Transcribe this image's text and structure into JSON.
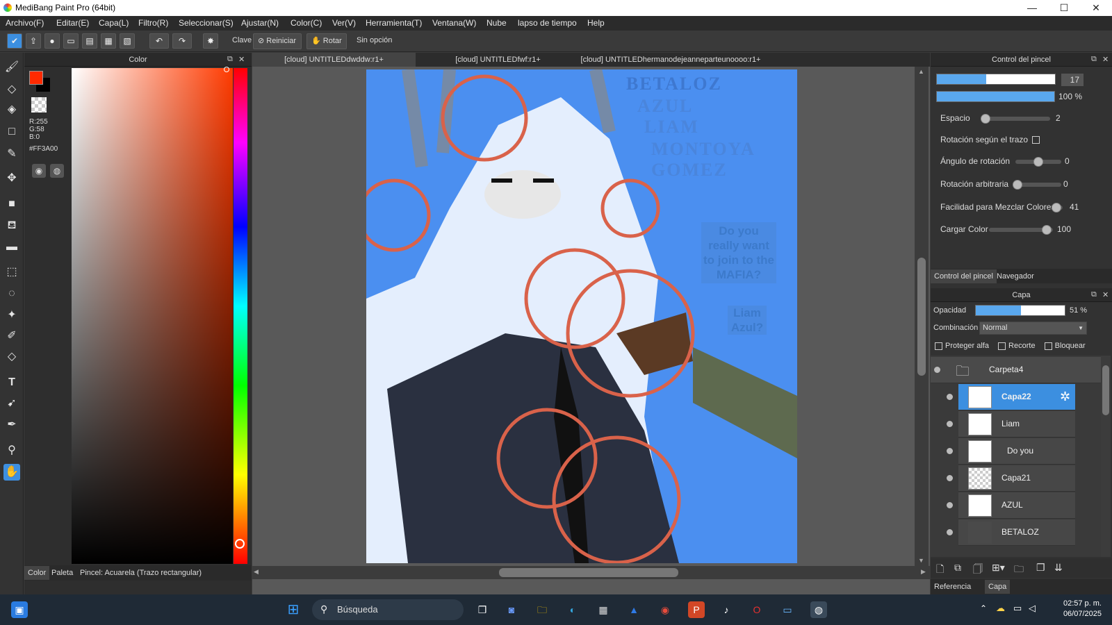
{
  "window": {
    "title": "MediBang Paint Pro (64bit)"
  },
  "menu": [
    "Archivo(F)",
    "Editar(E)",
    "Capa(L)",
    "Filtro(R)",
    "Seleccionar(S)",
    "Ajustar(N)",
    "Color(C)",
    "Ver(V)",
    "Herramienta(T)",
    "Ventana(W)",
    "Nube",
    "lapso de tiempo",
    "Help"
  ],
  "toolbar": {
    "clave": "Clave",
    "reiniciar": "Reiniciar",
    "rotar": "Rotar",
    "sin_opcion": "Sin opción"
  },
  "color_panel": {
    "title": "Color",
    "rgb": [
      "R:255",
      "G:58",
      "B:0"
    ],
    "hex": "#FF3A00",
    "fg_color": "#ff2a00",
    "bottom_tabs": [
      "Color",
      "Paleta"
    ],
    "brush_status": "Pincel: Acuarela (Trazo rectangular)"
  },
  "canvas": {
    "tabs": [
      "[cloud] UNTITLEDdwddw:r1+",
      "[cloud] UNTITLEDfwf:r1+",
      "[cloud] UNTITLEDhermanodejeanneparteunoooo:r1+"
    ],
    "art_text": {
      "betaloz": "BETALOZ",
      "azul": "AZUL",
      "liam": "LIAM",
      "montoya": "MONTOYA",
      "gomez": "GOMEZ",
      "do_you": "Do you really want to join to the MAFIA?",
      "liam_azul": "Liam Azul?"
    }
  },
  "brush_panel": {
    "title": "Control del pincel",
    "size": "17",
    "opacity": "100 %",
    "size_fill": 0.42,
    "rows": [
      {
        "label": "Espacio",
        "value": "2",
        "pos": 0.0
      },
      {
        "label": "Rotación según el trazo",
        "checkbox": true
      },
      {
        "label": "Ángulo de rotación",
        "value": "0",
        "pos": 0.5
      },
      {
        "label": "Rotación arbitraria",
        "value": "0",
        "pos": 0.0
      },
      {
        "label": "Facilidad para Mezclar Colores",
        "value": "41",
        "pos": 0.41
      },
      {
        "label": "Cargar Color",
        "value": "100",
        "pos": 1.0
      }
    ],
    "tabs": [
      "Control del pincel",
      "Navegador"
    ]
  },
  "layer_panel": {
    "title": "Capa",
    "opacity_label": "Opacidad",
    "opacity_value": "51 %",
    "opacity_fill": 0.51,
    "blend_label": "Combinación",
    "blend_value": "Normal",
    "checks": [
      "Proteger alfa",
      "Recorte",
      "Bloquear"
    ],
    "folder": "Carpeta4",
    "layers": [
      "Capa22",
      "Liam",
      "Do you",
      "Capa21",
      "AZUL",
      "BETALOZ"
    ],
    "bottom_tabs": [
      "Referencia",
      "Capa"
    ]
  },
  "taskbar": {
    "search": "Búsqueda",
    "time": "02:57 p. m.",
    "date": "06/07/2025"
  }
}
